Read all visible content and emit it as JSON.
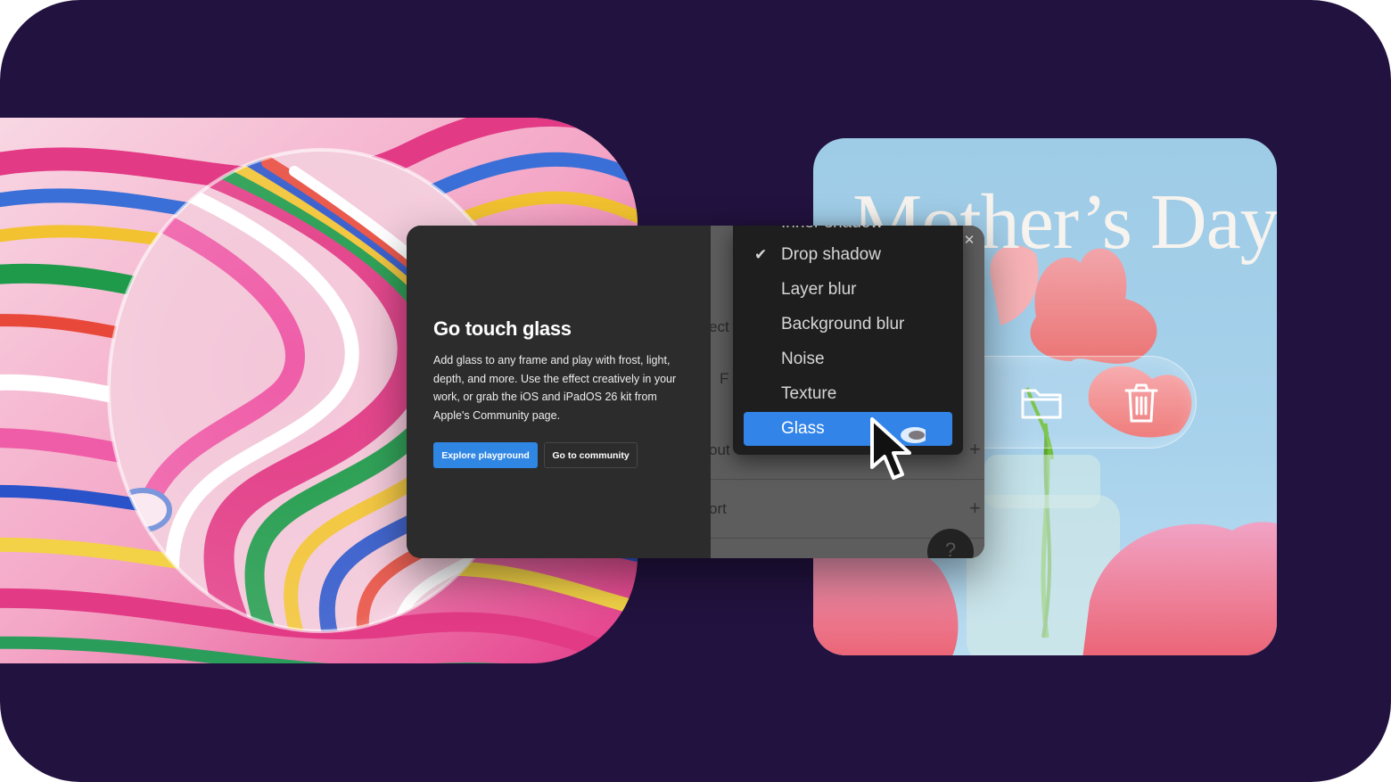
{
  "dialog": {
    "title": "Go touch glass",
    "body": "Add glass to any frame and play with frost, light, depth, and more. Use the effect creatively in your work, or grab the iOS and iPadOS 26 kit from Apple's Community page.",
    "primary_button": "Explore playground",
    "secondary_button": "Go to community",
    "close_icon": "✕"
  },
  "effects_menu": {
    "partial_item": "Inner shadow",
    "items": [
      {
        "label": "Drop shadow",
        "checked": true
      },
      {
        "label": "Layer blur",
        "checked": false
      },
      {
        "label": "Background blur",
        "checked": false
      },
      {
        "label": "Noise",
        "checked": false
      },
      {
        "label": "Texture",
        "checked": false
      },
      {
        "label": "Glass",
        "checked": false,
        "selected": true
      }
    ],
    "check_glyph": "✔"
  },
  "panel_fragments": {
    "row1": "ect",
    "row2": "F",
    "row3": "out",
    "row4": "ort",
    "row0": ")",
    "plus": "+",
    "help": "?"
  },
  "card": {
    "title": "Mother’s Day"
  },
  "glass_toolbar": {
    "icons": [
      "undo-arrow-icon",
      "folder-icon",
      "trash-icon"
    ]
  },
  "colors": {
    "background": "#22123f",
    "accent_blue": "#3284e8",
    "dialog_bg": "#2c2c2c",
    "menu_bg": "#1e1e1e"
  }
}
